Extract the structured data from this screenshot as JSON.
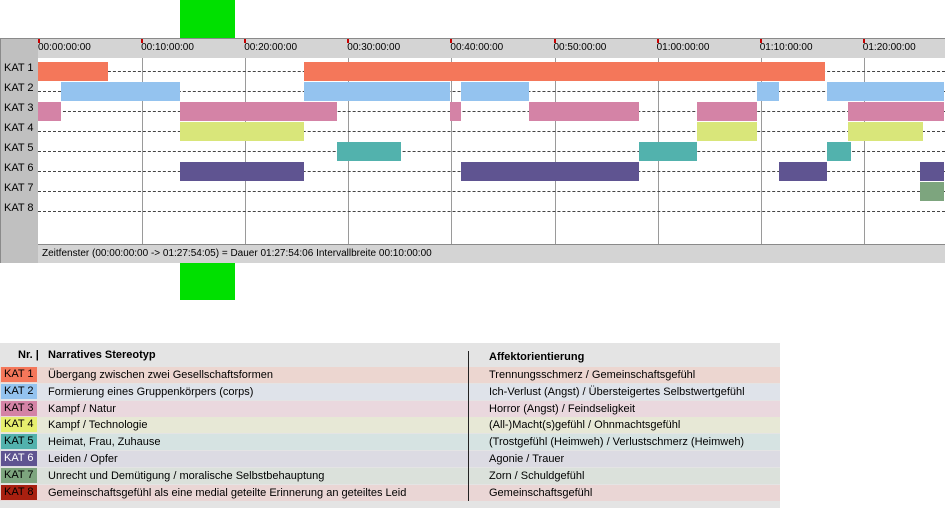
{
  "timeline": {
    "ticks": [
      "00:00:00:00",
      "00:10:00:00",
      "00:20:00:00",
      "00:30:00:00",
      "00:40:00:00",
      "00:50:00:00",
      "01:00:00:00",
      "01:10:00:00",
      "01:20:00:00"
    ],
    "rows": [
      "KAT 1",
      "KAT 2",
      "KAT 3",
      "KAT 4",
      "KAT 5",
      "KAT 6",
      "KAT 7",
      "KAT 8"
    ],
    "status": "Zeitfenster (00:00:00:00 -> 01:27:54:05) = Dauer 01:27:54:06    Intervallbreite 00:10:00:00",
    "colors": {
      "KAT 1": "#f4775a",
      "KAT 2": "#94c3ef",
      "KAT 3": "#d483a6",
      "KAT 4": "#d9e67a",
      "KAT 5": "#52b2ad",
      "KAT 6": "#5f5491",
      "KAT 7": "#7da57e",
      "KAT 8": "#a82010"
    },
    "segments_minutes": {
      "KAT 1": [
        [
          0,
          6.8
        ],
        [
          25.8,
          76.3
        ]
      ],
      "KAT 2": [
        [
          2.2,
          13.8
        ],
        [
          25.8,
          40.0
        ],
        [
          41.0,
          47.6
        ],
        [
          69.7,
          71.9
        ],
        [
          76.5,
          87.9
        ]
      ],
      "KAT 3": [
        [
          0,
          2.2
        ],
        [
          13.8,
          29.0
        ],
        [
          40.0,
          41.0
        ],
        [
          47.6,
          58.3
        ],
        [
          63.9,
          69.7
        ],
        [
          78.6,
          87.9
        ]
      ],
      "KAT 4": [
        [
          13.8,
          25.8
        ],
        [
          63.9,
          69.7
        ],
        [
          78.6,
          85.8
        ]
      ],
      "KAT 5": [
        [
          29.0,
          35.2
        ],
        [
          58.3,
          63.9
        ],
        [
          76.5,
          78.9
        ]
      ],
      "KAT 6": [
        [
          13.8,
          25.8
        ],
        [
          41.0,
          58.3
        ],
        [
          71.9,
          76.5
        ],
        [
          85.5,
          87.9
        ]
      ],
      "KAT 7": [
        [
          85.5,
          87.9
        ]
      ],
      "KAT 8": []
    }
  },
  "legend": {
    "header_nr": "Nr. |",
    "header_stereotyp": "Narratives Stereotyp",
    "header_affekt": "Affektorientierung",
    "rows": [
      {
        "kat": "KAT 1",
        "stereotyp": "Übergang zwischen zwei Gesellschaftsformen",
        "affekt": "Trennungsschmerz / Gemeinschaftsgefühl",
        "bg": "#f4775a",
        "fg": "#000000",
        "rowbg": "#ecd6d0"
      },
      {
        "kat": "KAT 2",
        "stereotyp": "Formierung eines Gruppenkörpers (corps)",
        "affekt": "Ich-Verlust (Angst) / Übersteigertes Selbstwertgefühl",
        "bg": "#94c3ef",
        "fg": "#000000",
        "rowbg": "#dfe3ea"
      },
      {
        "kat": "KAT 3",
        "stereotyp": "Kampf / Natur",
        "affekt": "Horror (Angst) / Feindseligkeit",
        "bg": "#d483a6",
        "fg": "#000000",
        "rowbg": "#ead8de"
      },
      {
        "kat": "KAT 4",
        "stereotyp": "Kampf / Technologie",
        "affekt": "(All-)Macht(s)gefühl / Ohnmachtsgefühl",
        "bg": "#e6ef6e",
        "fg": "#000000",
        "rowbg": "#e7e8d6"
      },
      {
        "kat": "KAT 5",
        "stereotyp": "Heimat, Frau, Zuhause",
        "affekt": "(Trostgefühl (Heimweh) / Verlustschmerz (Heimweh)",
        "bg": "#52b2ad",
        "fg": "#000000",
        "rowbg": "#d6e3e2"
      },
      {
        "kat": "KAT 6",
        "stereotyp": "Leiden / Opfer",
        "affekt": "Agonie / Trauer",
        "bg": "#5f5491",
        "fg": "#ffffff",
        "rowbg": "#dcdbe3"
      },
      {
        "kat": "KAT 7",
        "stereotyp": "Unrecht und Demütigung / moralische Selbstbehauptung",
        "affekt": "Zorn / Schuldgefühl",
        "bg": "#7da57e",
        "fg": "#000000",
        "rowbg": "#dbe1db"
      },
      {
        "kat": "KAT 8",
        "stereotyp": "Gemeinschaftsgefühl als eine medial geteilte Erinnerung an geteiltes Leid",
        "affekt": "Gemeinschaftsgefühl",
        "bg": "#a82010",
        "fg": "#000000",
        "rowbg": "#ead6d5"
      }
    ]
  }
}
